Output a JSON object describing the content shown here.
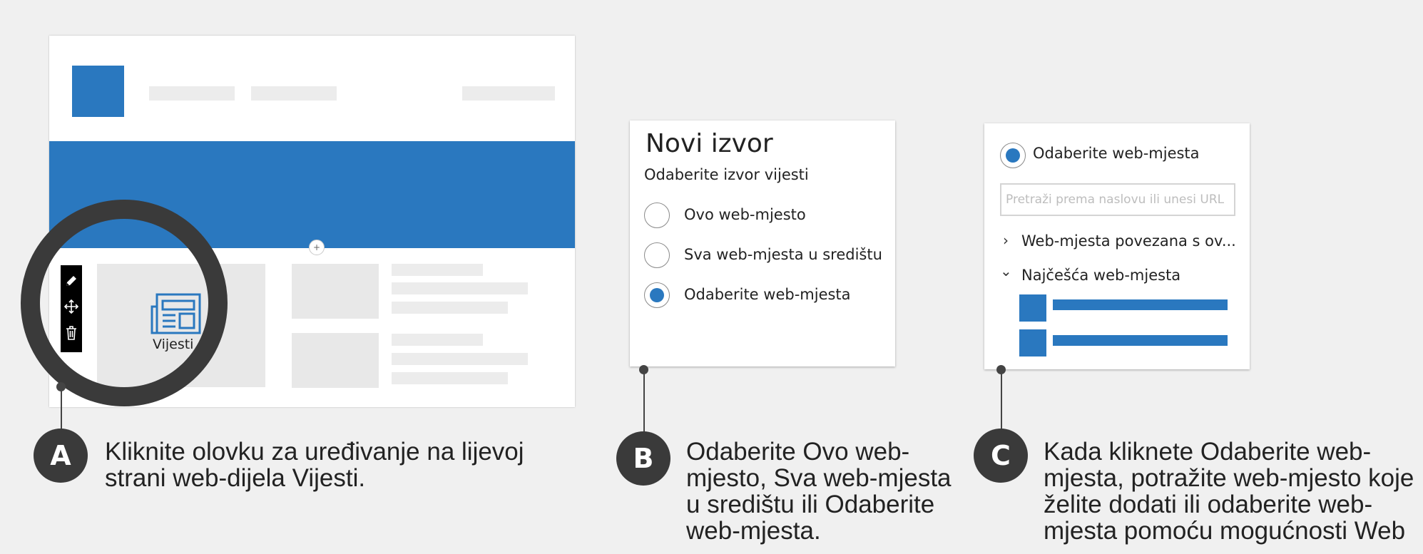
{
  "mockup": {
    "news_label": "Vijesti",
    "add_symbol": "+"
  },
  "panel_b": {
    "title": "Novi izvor",
    "subtitle": "Odaberite izvor vijesti",
    "options": [
      {
        "label": "Ovo web-mjesto",
        "selected": false
      },
      {
        "label": "Sva web-mjesta u središtu",
        "selected": false
      },
      {
        "label": "Odaberite web-mjesta",
        "selected": true
      }
    ]
  },
  "panel_c": {
    "radio_label": "Odaberite web-mjesta",
    "search_placeholder": "Pretraži prema naslovu ili unesi URL",
    "associated_sites": "Web-mjesta povezana s ov...",
    "frequent_sites": "Najčešća web-mjesta",
    "chevron_collapsed": "›",
    "chevron_expanded": "⌄"
  },
  "callouts": [
    {
      "badge": "A",
      "text": "Kliknite olovku za uređivanje na lijevoj strani web-dijela Vijesti."
    },
    {
      "badge": "B",
      "text": "Odaberite Ovo web-mjesto, Sva web-mjesta u središtu ili Odaberite web-mjesta."
    },
    {
      "badge": "C",
      "text": "Kada kliknete Odaberite web-mjesta, potražite web-mjesto koje želite dodati ili odaberite web-mjesta pomoću mogućnosti Web"
    }
  ],
  "colors": {
    "accent": "#2a78bf",
    "badge": "#3a3a3a",
    "background": "#f0f0f0"
  }
}
